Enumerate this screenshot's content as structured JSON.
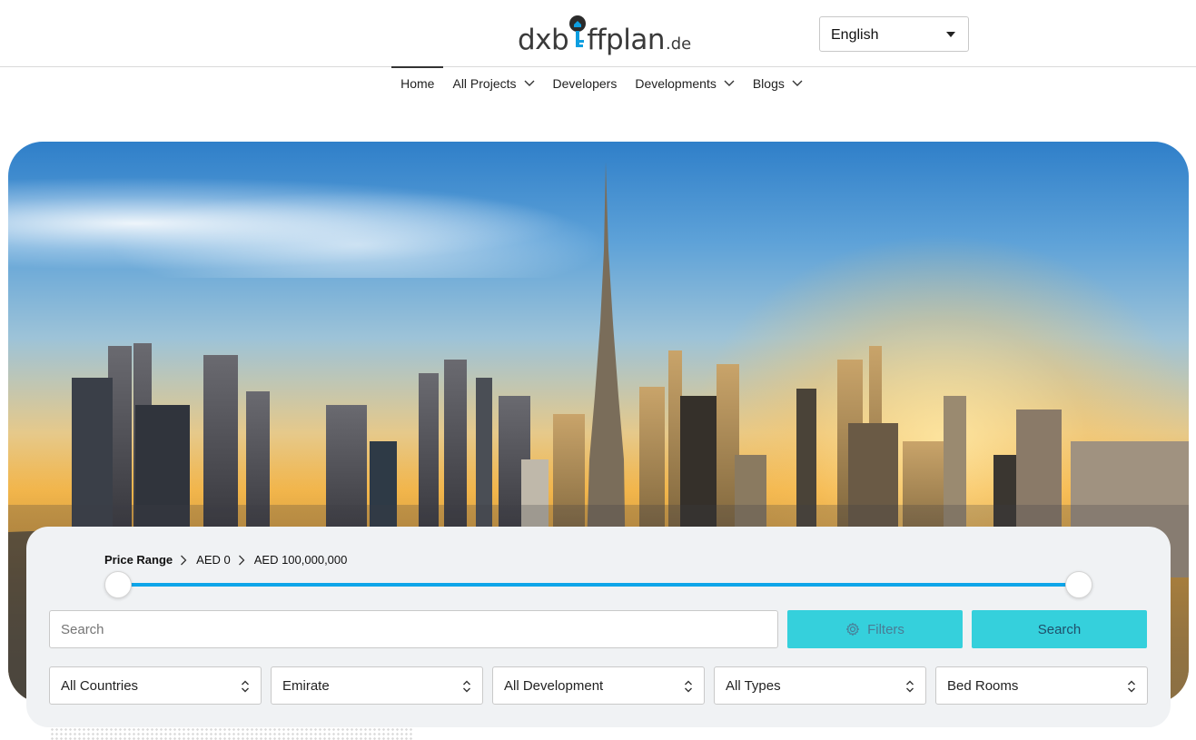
{
  "header": {
    "logo_text_left": "dxb",
    "logo_text_right": "ffplan",
    "logo_tld": ".de",
    "language": {
      "selected": "English"
    }
  },
  "nav": {
    "items": [
      {
        "label": "Home",
        "active": true,
        "dropdown": false
      },
      {
        "label": "All Projects",
        "dropdown": true
      },
      {
        "label": "Developers",
        "dropdown": false
      },
      {
        "label": "Developments",
        "dropdown": true
      },
      {
        "label": "Blogs",
        "dropdown": true
      }
    ]
  },
  "search_panel": {
    "price_range": {
      "title": "Price Range",
      "min_label": "AED 0",
      "max_label": "AED 100,000,000",
      "min_value": 0,
      "max_value": 100000000
    },
    "search_placeholder": "Search",
    "filters_label": "Filters",
    "search_label": "Search",
    "selects": [
      {
        "selected": "All Countries"
      },
      {
        "selected": "Emirate"
      },
      {
        "selected": "All Development"
      },
      {
        "selected": "All Types"
      },
      {
        "selected": "Bed Rooms"
      }
    ]
  },
  "colors": {
    "accent": "#35d0dc",
    "slider": "#0ea5e9",
    "panel_bg": "#f0f2f4",
    "logo_key": "#0e9ee0"
  },
  "icons": {
    "filters": "gear-icon",
    "nav_dropdown": "chevron-down-icon",
    "language_dropdown": "caret-down-icon",
    "select": "up-down-chevron-icon",
    "breadcrumb_sep": "chevron-right-icon"
  }
}
